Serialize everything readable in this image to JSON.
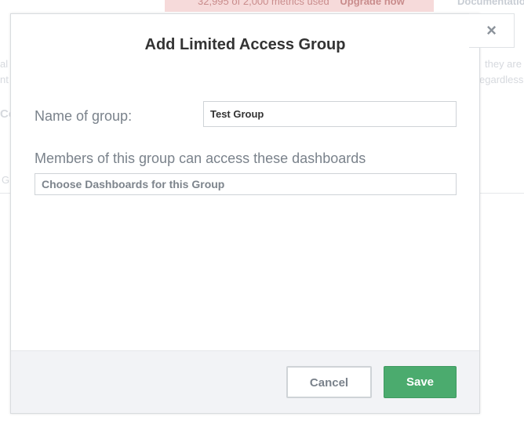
{
  "background": {
    "banner_count": "32,995",
    "banner_of": "of",
    "banner_limit": "2,000",
    "banner_suffix": "metrics used",
    "banner_link": "Upgrade now",
    "doc_link": "Documentation",
    "fragments": [
      "al",
      "nt",
      "Co",
      "Gr",
      "they are",
      "egardless"
    ]
  },
  "modal": {
    "title": "Add Limited Access Group",
    "close_symbol": "×",
    "name_label": "Name of group:",
    "name_value": "Test Group",
    "dashboards_label": "Members of this group can access these dashboards",
    "dashboards_placeholder": "Choose Dashboards for this Group",
    "cancel_label": "Cancel",
    "save_label": "Save"
  },
  "colors": {
    "save_button": "#4bab6e",
    "footer_bg": "#f2f3f6",
    "banner_bg": "#f6dada"
  }
}
